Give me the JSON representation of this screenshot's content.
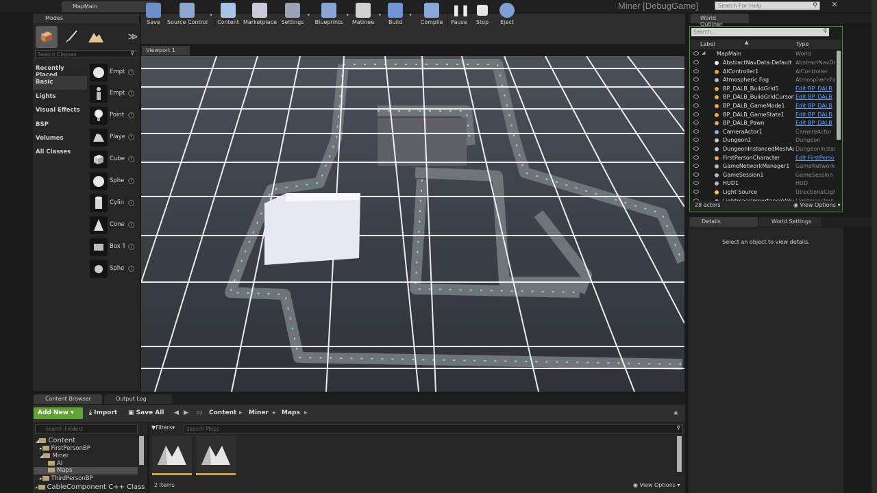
{
  "window": {
    "tab": "MapMain",
    "title": "Miner [DebugGame]",
    "help_placeholder": "Search For Help"
  },
  "modes": {
    "tab": "Modes",
    "search_placeholder": "Search Classes",
    "categories": [
      "Recently Placed",
      "Basic",
      "Lights",
      "Visual Effects",
      "BSP",
      "Volumes",
      "All Classes"
    ],
    "selected_category": "Basic",
    "items": [
      "Empt",
      "Empt",
      "Point",
      "Playe",
      "Cube",
      "Sphe",
      "Cylin",
      "Cone",
      "Box T",
      "Sphe"
    ]
  },
  "toolbar": {
    "buttons": [
      "Save",
      "Source Control",
      "Content",
      "Marketplace",
      "Settings",
      "Blueprints",
      "Matinee",
      "Build",
      "Compile",
      "Pause",
      "Stop",
      "Eject"
    ]
  },
  "viewport": {
    "tab": "Viewport 1"
  },
  "outliner": {
    "tab": "World Outliner",
    "search_placeholder": "Search...",
    "col_label": "Label",
    "col_type": "Type",
    "root": {
      "name": "MapMain",
      "type": "World"
    },
    "rows": [
      {
        "name": "AbstractNavData-Default",
        "type": "AbstractNavDa",
        "link": false
      },
      {
        "name": "AIController1",
        "type": "AIController",
        "link": false
      },
      {
        "name": "Atmospheric Fog",
        "type": "AtmosphericFo",
        "link": false
      },
      {
        "name": "BP_DALB_BuildGrid5",
        "type": "Edit BP_DALB",
        "link": true
      },
      {
        "name": "BP_DALB_BuildGridCursor5",
        "type": "Edit BP_DALB",
        "link": true
      },
      {
        "name": "BP_DALB_GameMode1",
        "type": "Edit BP_DALB",
        "link": true
      },
      {
        "name": "BP_DALB_GameState1",
        "type": "Edit BP_DALB",
        "link": true
      },
      {
        "name": "BP_DALB_Pawn",
        "type": "Edit BP_DALB",
        "link": true
      },
      {
        "name": "CameraActor1",
        "type": "CameraActor",
        "link": false
      },
      {
        "name": "Dungeon1",
        "type": "Dungeon",
        "link": false
      },
      {
        "name": "DungeonInstancedMeshActo",
        "type": "DungeonInstan",
        "link": false
      },
      {
        "name": "FirstPersonCharacter",
        "type": "Edit FirstPerso",
        "link": true
      },
      {
        "name": "GameNetworkManager1",
        "type": "GameNetworkM",
        "link": false
      },
      {
        "name": "GameSession1",
        "type": "GameSession",
        "link": false
      },
      {
        "name": "HUD1",
        "type": "HUD",
        "link": false
      },
      {
        "name": "Light Source",
        "type": "DirectionalLigh",
        "link": false
      },
      {
        "name": "LightmassImportanceVolum",
        "type": "LightmassImp",
        "link": false
      }
    ],
    "actor_count": "28 actors",
    "view_options": "View Options"
  },
  "details": {
    "tab": "Details",
    "tab2": "World Settings",
    "message": "Select an object to view details."
  },
  "bottom": {
    "tab_content_browser": "Content Browser",
    "tab_output_log": "Output Log",
    "add_new": "Add New",
    "import": "Import",
    "save_all": "Save All",
    "breadcrumb": [
      "Content",
      "Miner",
      "Maps"
    ],
    "folder_search_placeholder": "Search Folders",
    "folders": [
      "Content",
      "FirstPersonBP",
      "Miner",
      "AI",
      "Maps",
      "ThirdPersonBP",
      "CableComponent C++ Class"
    ],
    "filters": "Filters",
    "asset_search_placeholder": "Search Maps",
    "item_count": "2 items",
    "view_options": "View Options"
  },
  "colors": {
    "accent_green": "#60a433",
    "link_blue": "#5fa0ff",
    "asset_border": "#d3a13c"
  }
}
